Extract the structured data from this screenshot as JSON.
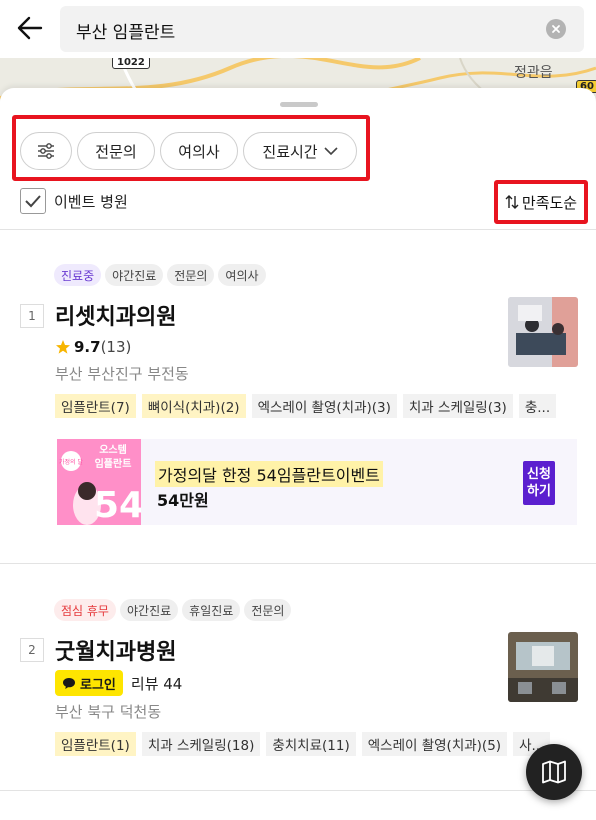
{
  "search": {
    "query": "부산 임플란트"
  },
  "map": {
    "place_label": "정관읍",
    "road_number": "1022",
    "road_number_2": "60"
  },
  "filters": {
    "chips": [
      {
        "label": ""
      },
      {
        "label": "전문의"
      },
      {
        "label": "여의사"
      },
      {
        "label": "진료시간"
      }
    ],
    "event_checkbox_label": "이벤트 병원",
    "event_checked": true,
    "sort_label": "만족도순"
  },
  "results": [
    {
      "rank": "1",
      "tags": [
        "진료중",
        "야간진료",
        "전문의",
        "여의사"
      ],
      "name": "리셋치과의원",
      "rating": "9.7",
      "rating_count": "(13)",
      "address": "부산 부산진구 부전동",
      "keywords": [
        "임플란트(7)",
        "뼈이식(치과)(2)",
        "엑스레이 촬영(치과)(3)",
        "치과 스케일링(3)",
        "충..."
      ],
      "highlighted_keywords": [
        0,
        1
      ],
      "event": {
        "title": "가정의달 한정 54임플란트이벤트",
        "price": "54만원",
        "apply_label_1": "신청",
        "apply_label_2": "하기",
        "image_text_1": "오스템",
        "image_text_2": "임플란트",
        "image_text_3": "54",
        "image_badge": "가정의 달"
      }
    },
    {
      "rank": "2",
      "tags": [
        "점심 휴무",
        "야간진료",
        "휴일진료",
        "전문의"
      ],
      "name": "굿월치과병원",
      "login_label": "로그인",
      "review_label": "리뷰 44",
      "address": "부산 북구 덕천동",
      "keywords": [
        "임플란트(1)",
        "치과 스케일링(18)",
        "충치치료(11)",
        "엑스레이 촬영(치과)(5)",
        "사..."
      ],
      "highlighted_keywords": [
        0
      ]
    }
  ],
  "colors": {
    "highlight_red": "#e8141f",
    "purple_tag": "#6a3bd2",
    "red_tag": "#e5383b",
    "apply_button": "#5b1fcf",
    "kakao_yellow": "#fee500"
  }
}
